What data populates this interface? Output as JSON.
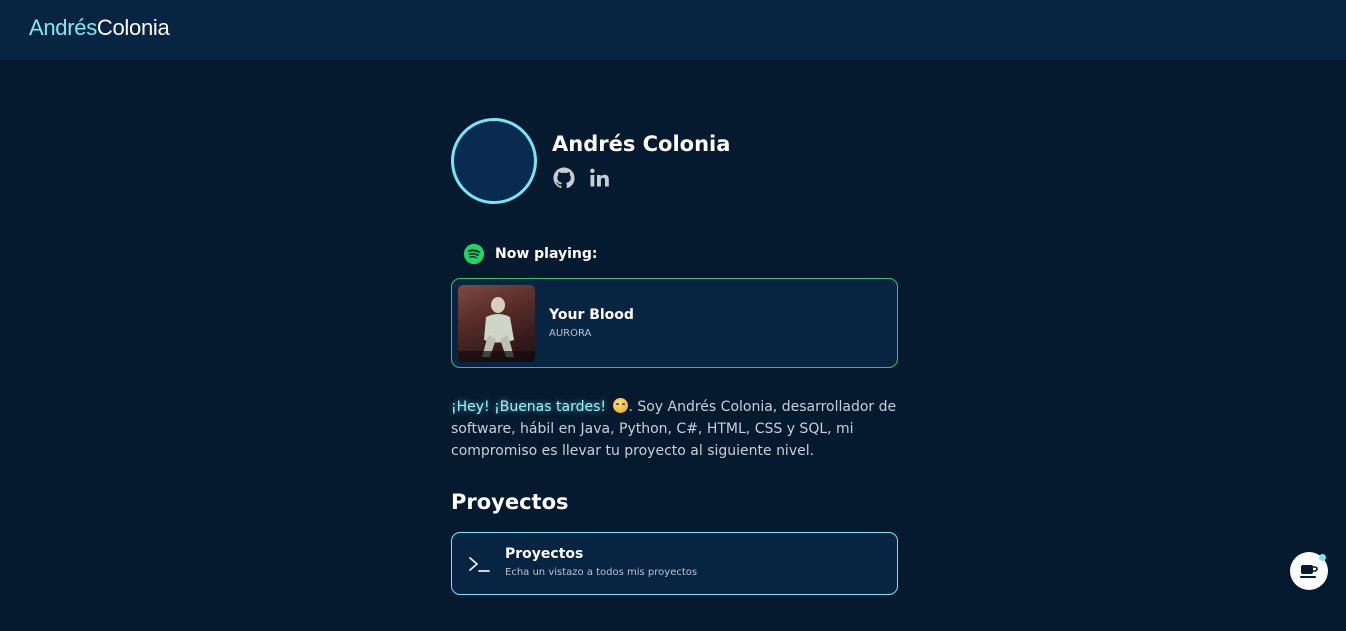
{
  "brand": {
    "first": "Andrés",
    "last": "Colonia"
  },
  "profile": {
    "name": "Andrés Colonia",
    "socials": [
      {
        "icon": "github-icon"
      },
      {
        "icon": "linkedin-icon"
      }
    ]
  },
  "now_playing": {
    "label": "Now playing:",
    "icon": "spotify-icon",
    "track": {
      "title": "Your Blood",
      "artist": "AURORA"
    }
  },
  "bio": {
    "greeting": "¡Hey! ¡Buenas tardes!",
    "text": ". Soy Andrés Colonia, desarrollador de software, hábil en Java, Python, C#, HTML, CSS y SQL, mi compromiso es llevar tu proyecto al siguiente nivel."
  },
  "projects_section": {
    "title": "Proyectos",
    "cards": [
      {
        "title": "Proyectos",
        "description": "Echa un vistazo a todos mis proyectos",
        "icon": "terminal-icon"
      }
    ]
  },
  "colors": {
    "background": "#051a2e",
    "header": "#082443",
    "accent": "#78e6f0",
    "spotify": "#1ed760"
  }
}
